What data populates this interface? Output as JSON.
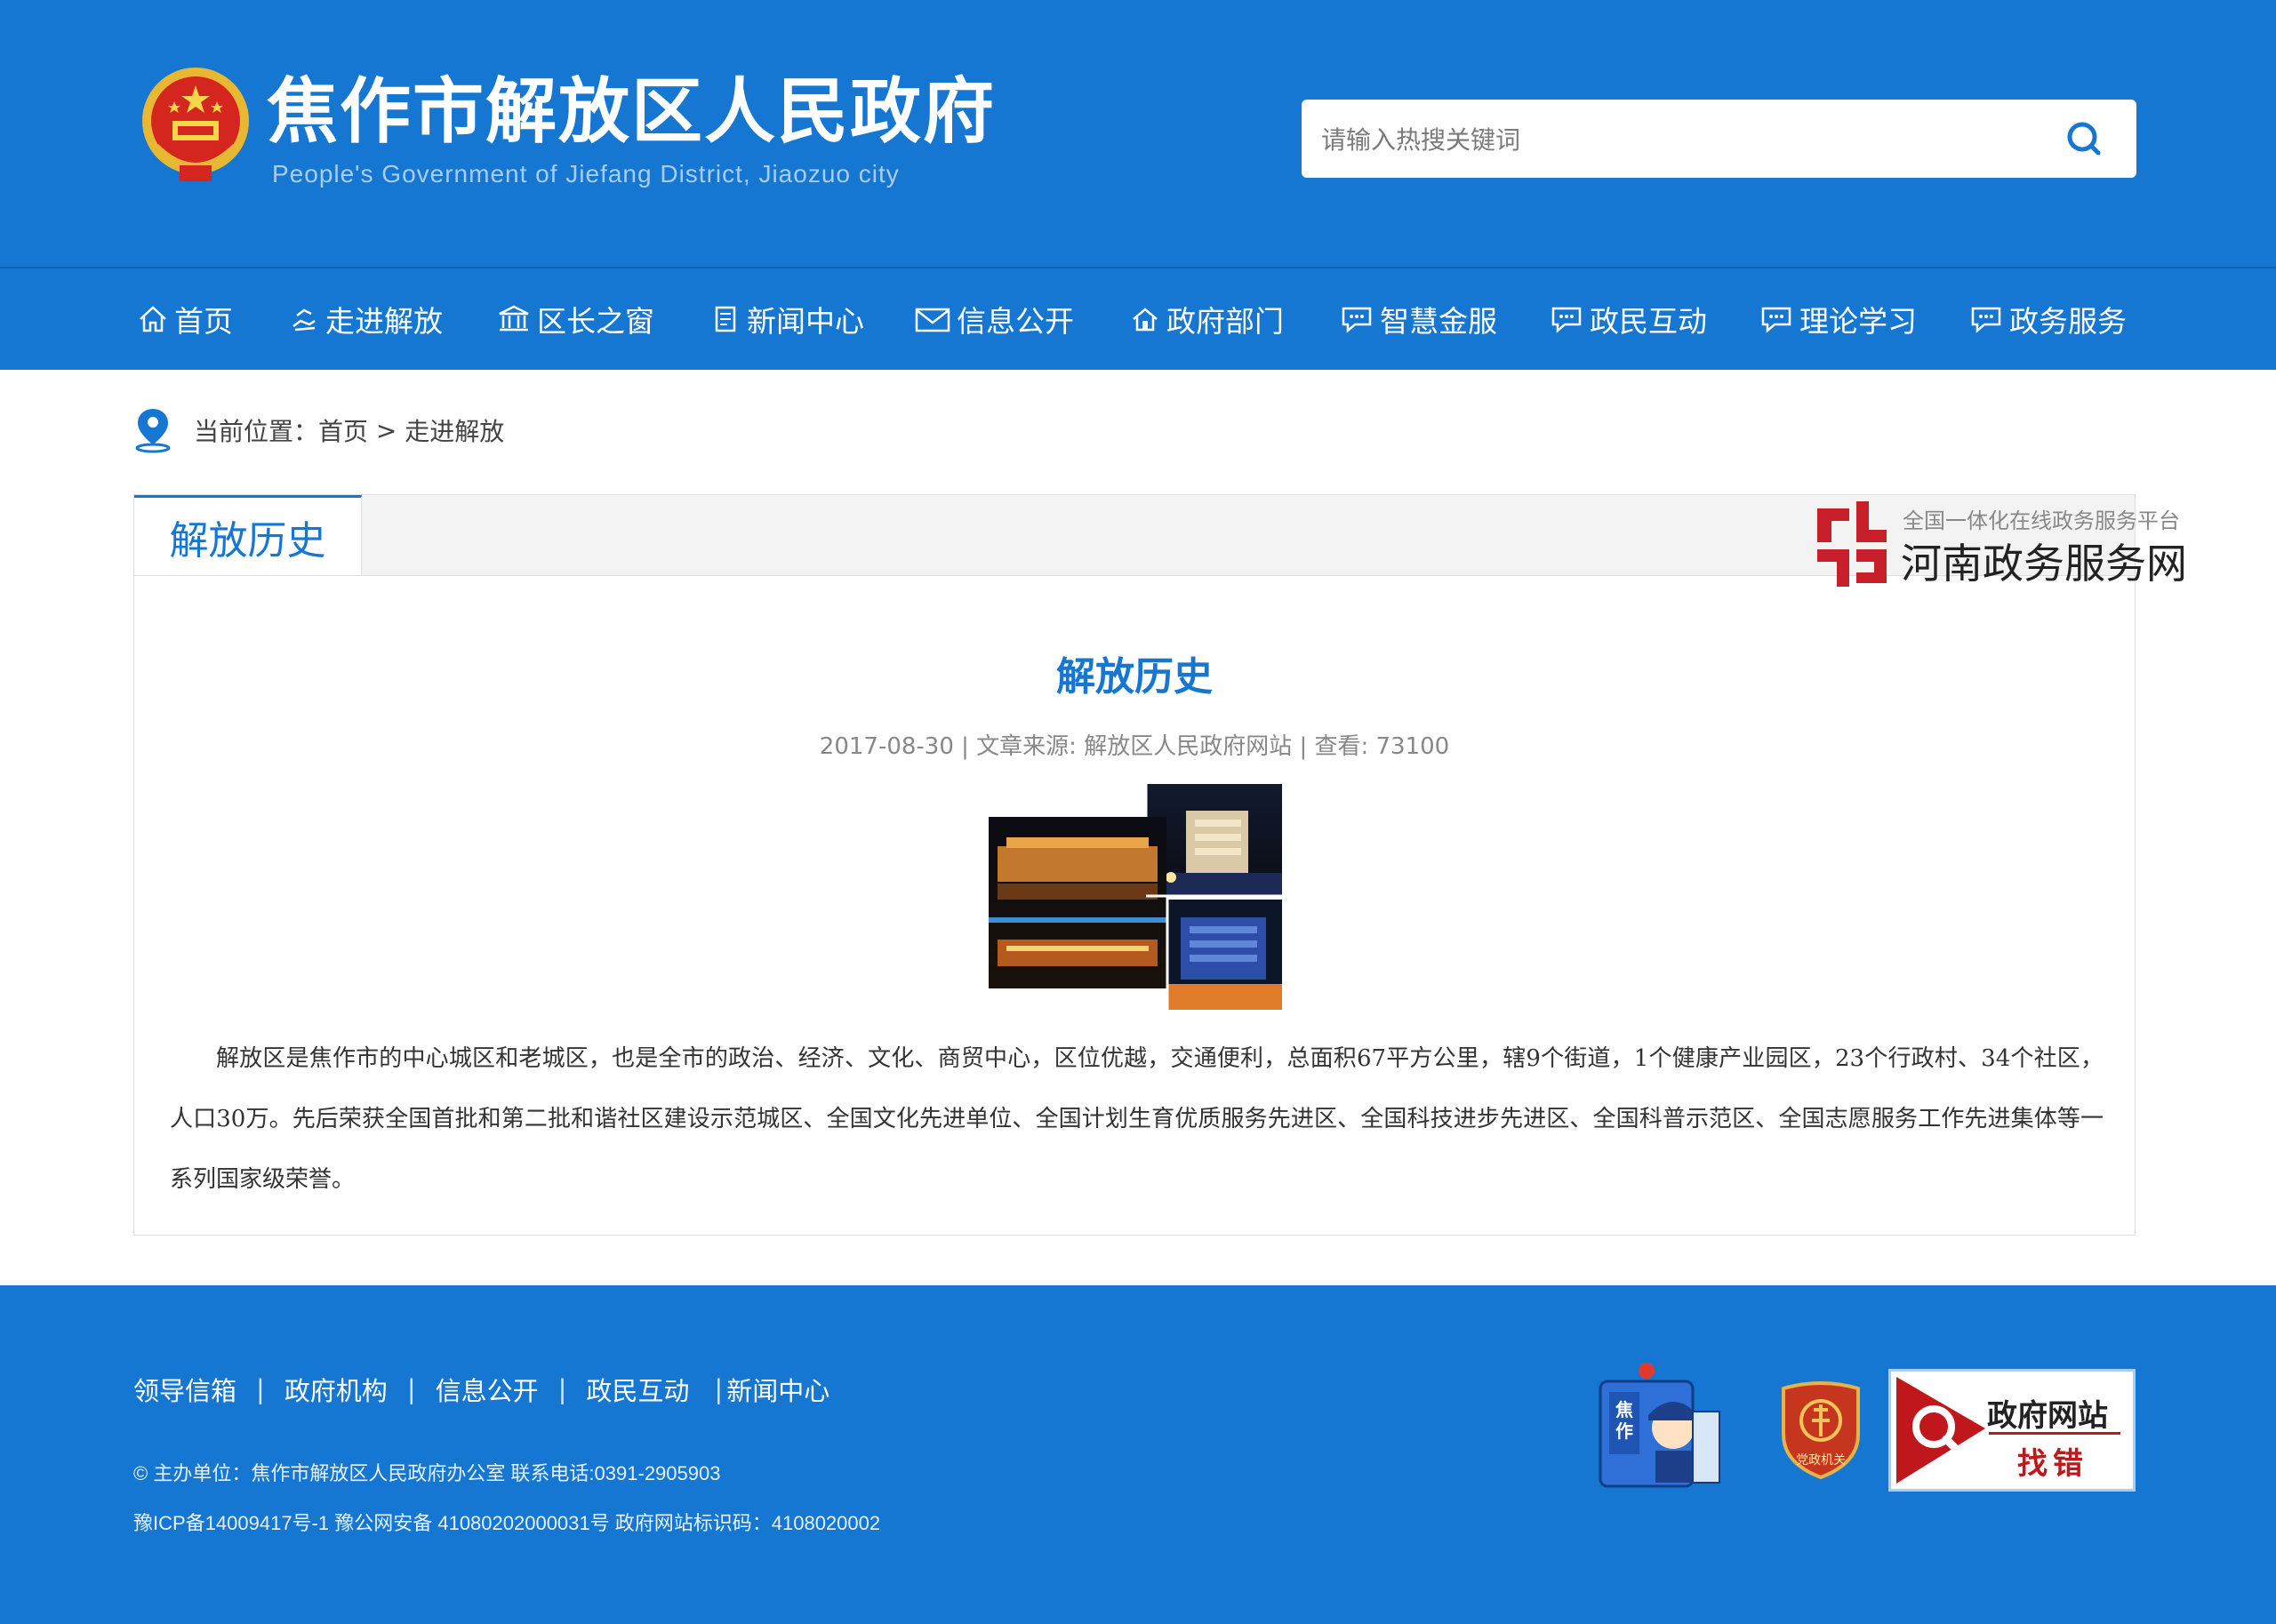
{
  "header": {
    "title": "焦作市解放区人民政府",
    "subtitle": "People's Government of Jiefang District, Jiaozuo city",
    "search_placeholder": "请输入热搜关键词"
  },
  "nav": [
    {
      "label": "首页",
      "icon": "home-icon"
    },
    {
      "label": "走进解放",
      "icon": "hand-icon"
    },
    {
      "label": "区长之窗",
      "icon": "government-building-icon"
    },
    {
      "label": "新闻中心",
      "icon": "document-icon"
    },
    {
      "label": "信息公开",
      "icon": "mail-icon"
    },
    {
      "label": "政府部门",
      "icon": "house-icon"
    },
    {
      "label": "智慧金服",
      "icon": "chat-icon"
    },
    {
      "label": "政民互动",
      "icon": "chat-icon"
    },
    {
      "label": "理论学习",
      "icon": "chat-icon"
    },
    {
      "label": "政务服务",
      "icon": "chat-icon"
    }
  ],
  "breadcrumb": {
    "prefix": "当前位置：",
    "home": "首页",
    "separator": " > ",
    "current": "走进解放"
  },
  "panel": {
    "tab": "解放历史",
    "title": "解放历史",
    "meta": "2017-08-30 | 文章来源: 解放区人民政府网站 | 查看: 73100",
    "body": "解放区是焦作市的中心城区和老城区，也是全市的政治、经济、文化、商贸中心，区位优越，交通便利，总面积67平方公里，辖9个街道，1个健康产业园区，23个行政村、34个社区，人口30万。先后荣获全国首批和第二批和谐社区建设示范城区、全国文化先进单位、全国计划生育优质服务先进区、全国科技进步先进区、全国科普示范区、全国志愿服务工作先进集体等一系列国家级荣誉。"
  },
  "badge": {
    "small": "全国一体化在线政务服务平台",
    "big": "河南政务服务网"
  },
  "footer": {
    "links": [
      "领导信箱",
      "政府机构",
      "信息公开",
      "政民互动",
      "新闻中心"
    ],
    "line1": "© 主办单位：焦作市解放区人民政府办公室    联系电话:0391-2905903",
    "line2": "豫ICP备14009417号-1    豫公网安备 41080202000031号    政府网站标识码：4108020002",
    "police_text": "焦作",
    "party_text": "党政机关",
    "findfault_l1": "政府网站",
    "findfault_l2": "找错"
  },
  "colors": {
    "brand_blue": "#1677d2",
    "alert_red": "#c0171c"
  }
}
